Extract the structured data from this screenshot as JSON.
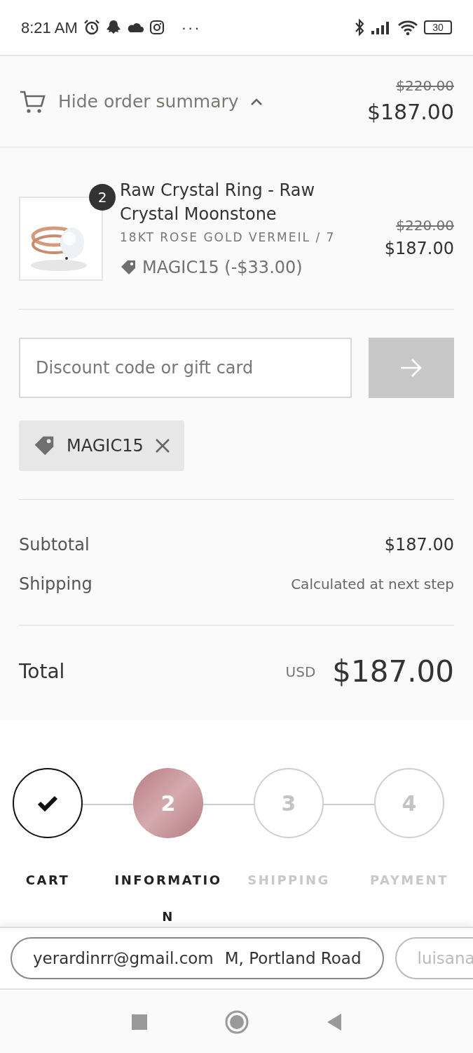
{
  "status_bar": {
    "time": "8:21 AM",
    "more": "···",
    "battery": "30"
  },
  "summary_toggle": {
    "label": "Hide order summary",
    "expanded": true,
    "original_price": "$220.00",
    "price": "$187.00"
  },
  "line_items": [
    {
      "quantity": "2",
      "title": "Raw Crystal Ring - Raw Crystal Moonstone",
      "variant": "18KT ROSE GOLD VERMEIL / 7",
      "discount": "MAGIC15 (-$33.00)",
      "original_price": "$220.00",
      "price": "$187.00"
    }
  ],
  "discount_field": {
    "placeholder": "Discount code or gift card"
  },
  "applied_codes": [
    {
      "code": "MAGIC15"
    }
  ],
  "totals": [
    {
      "label": "Subtotal",
      "value": "$187.00",
      "kind": "amount"
    },
    {
      "label": "Shipping",
      "value": "Calculated at next step",
      "kind": "note"
    }
  ],
  "total": {
    "label": "Total",
    "currency": "USD",
    "value": "$187.00"
  },
  "steps": [
    {
      "label": "CART",
      "done": true,
      "selected": false
    },
    {
      "label": "INFORMATION",
      "number": "2",
      "done": false,
      "selected": true
    },
    {
      "label": "SHIPPING",
      "number": "3",
      "done": false,
      "selected": false
    },
    {
      "label": "PAYMENT",
      "number": "4",
      "done": false,
      "selected": false
    }
  ],
  "autofill": [
    {
      "email": "yerardinrr@gmail.com",
      "address": "M, Portland Road",
      "faded": false
    },
    {
      "email": "luisana",
      "faded": true
    }
  ]
}
